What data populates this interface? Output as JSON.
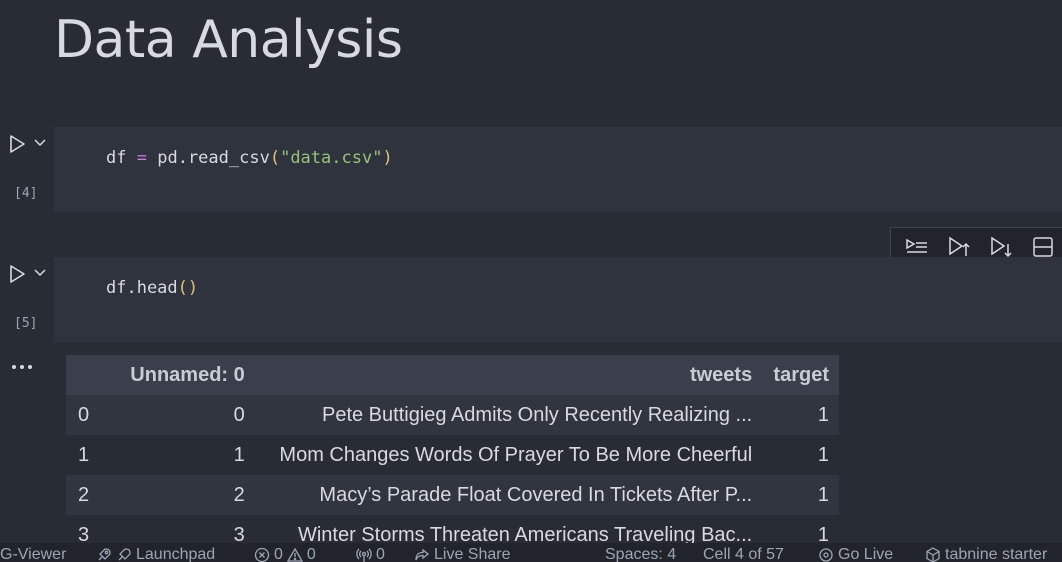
{
  "markdown": {
    "heading": "Data Analysis"
  },
  "cells": [
    {
      "exec_count": "[4]",
      "code": {
        "var": "df",
        "op": "=",
        "fn": "pd.read_csv",
        "open": "(",
        "arg": "\"data.csv\"",
        "close": ")"
      }
    },
    {
      "exec_count": "[5]",
      "code": {
        "expr": "df.head",
        "open": "(",
        "close": ")"
      }
    }
  ],
  "cell_toolbar": {
    "items": [
      "run-by-line",
      "execute-above",
      "execute-below",
      "split-cell"
    ]
  },
  "output": {
    "more_label": "···",
    "columns": [
      "",
      "Unnamed: 0",
      "tweets",
      "target"
    ],
    "rows": [
      {
        "index": "0",
        "unnamed": "0",
        "tweets": "Pete Buttigieg Admits Only Recently Realizing ...",
        "target": "1"
      },
      {
        "index": "1",
        "unnamed": "1",
        "tweets": "Mom Changes Words Of Prayer To Be More Cheerful",
        "target": "1"
      },
      {
        "index": "2",
        "unnamed": "2",
        "tweets": "Macy’s Parade Float Covered In Tickets After P...",
        "target": "1"
      },
      {
        "index": "3",
        "unnamed": "3",
        "tweets": "Winter Storms Threaten Americans Traveling Bac...",
        "target": "1"
      }
    ]
  },
  "statusbar": {
    "viewer": "G-Viewer",
    "launchpad": "Launchpad",
    "errors": "0",
    "warnings": "0",
    "ports": "0",
    "live_share": "Live Share",
    "spaces": "Spaces: 4",
    "cell_pos": "Cell 4 of 57",
    "go_live": "Go Live",
    "tabnine": "tabnine starter"
  },
  "colors": {
    "background": "#282c34",
    "cell_editor": "#2e333d",
    "string": "#98c379",
    "keyword_op": "#c678dd",
    "paren": "#e5c07b"
  }
}
